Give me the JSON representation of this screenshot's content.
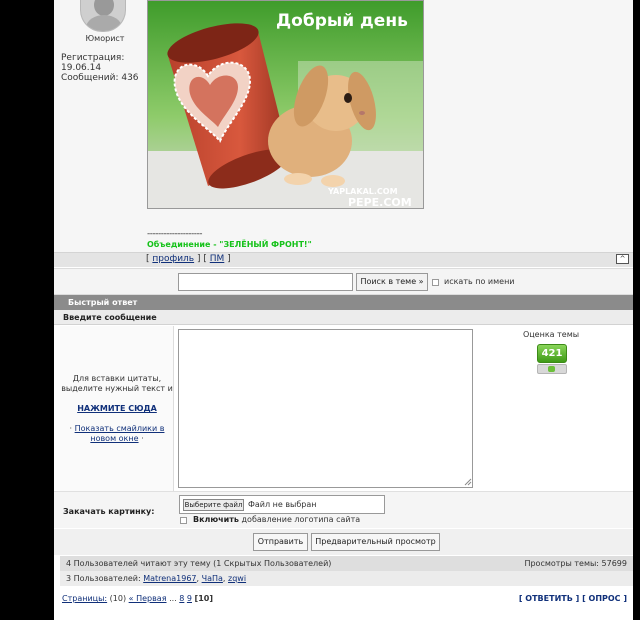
{
  "author": {
    "rank": "Юморист",
    "reg_label": "Регистрация:",
    "reg_date": "19.06.14",
    "messages": "Сообщений: 436"
  },
  "post": {
    "image_caption": "Добрый день",
    "image_watermark_1": "YAPLAKAL.COM",
    "image_watermark_2": "PEPE.COM",
    "signature_dashes": "--------------------",
    "signature_text": "Объединение - \"ЗЕЛЁНЫЙ ФРОНТ!\""
  },
  "post_links": {
    "open_bracket": "[",
    "profile": "профиль",
    "sep": "] [",
    "pm": "ПМ",
    "close_bracket": "]",
    "top": "^"
  },
  "search": {
    "button": "Поиск в теме »",
    "checkbox_label": "искать по имени"
  },
  "quick_reply": {
    "title": "Быстрый ответ",
    "enter_message": "Введите сообщение",
    "quote_hint": "Для вставки цитаты, выделите нужный текст и",
    "quote_click": "НАЖМИТЕ СЮДА",
    "smiles_prefix": "·",
    "smiles_link": "Показать смайлики в новом окне",
    "smiles_suffix": "·",
    "rating_label": "Оценка темы",
    "rating_value": "421",
    "upload_label": "Закачать картинку:",
    "file_button": "Выберите файл",
    "file_status": "Файл не выбран",
    "logo_bold": "Включить",
    "logo_rest": "добавление логотипа сайта",
    "submit": "Отправить",
    "preview": "Предварительный просмотр"
  },
  "stats": {
    "readers": "4 Пользователей читают эту тему (1 Скрытых Пользователей)",
    "views": "Просмотры темы: 57699",
    "users_prefix": "3 Пользователей:",
    "users": [
      "Matrena1967",
      "ЧаПа",
      "zqwi"
    ]
  },
  "pagination": {
    "label": "Страницы:",
    "count": "(10)",
    "first": "« Первая",
    "ellipsis": "...",
    "p8": "8",
    "p9": "9",
    "current": "[10]"
  },
  "actions": {
    "reply": "[ ОТВЕТИТЬ ]",
    "poll": "[ ОПРОС ]"
  },
  "colors": {
    "signature_green": "#16c21a",
    "rating_green": "#3f9a17",
    "header_gray": "#8b8b8b",
    "link_blue": "#10307a"
  }
}
